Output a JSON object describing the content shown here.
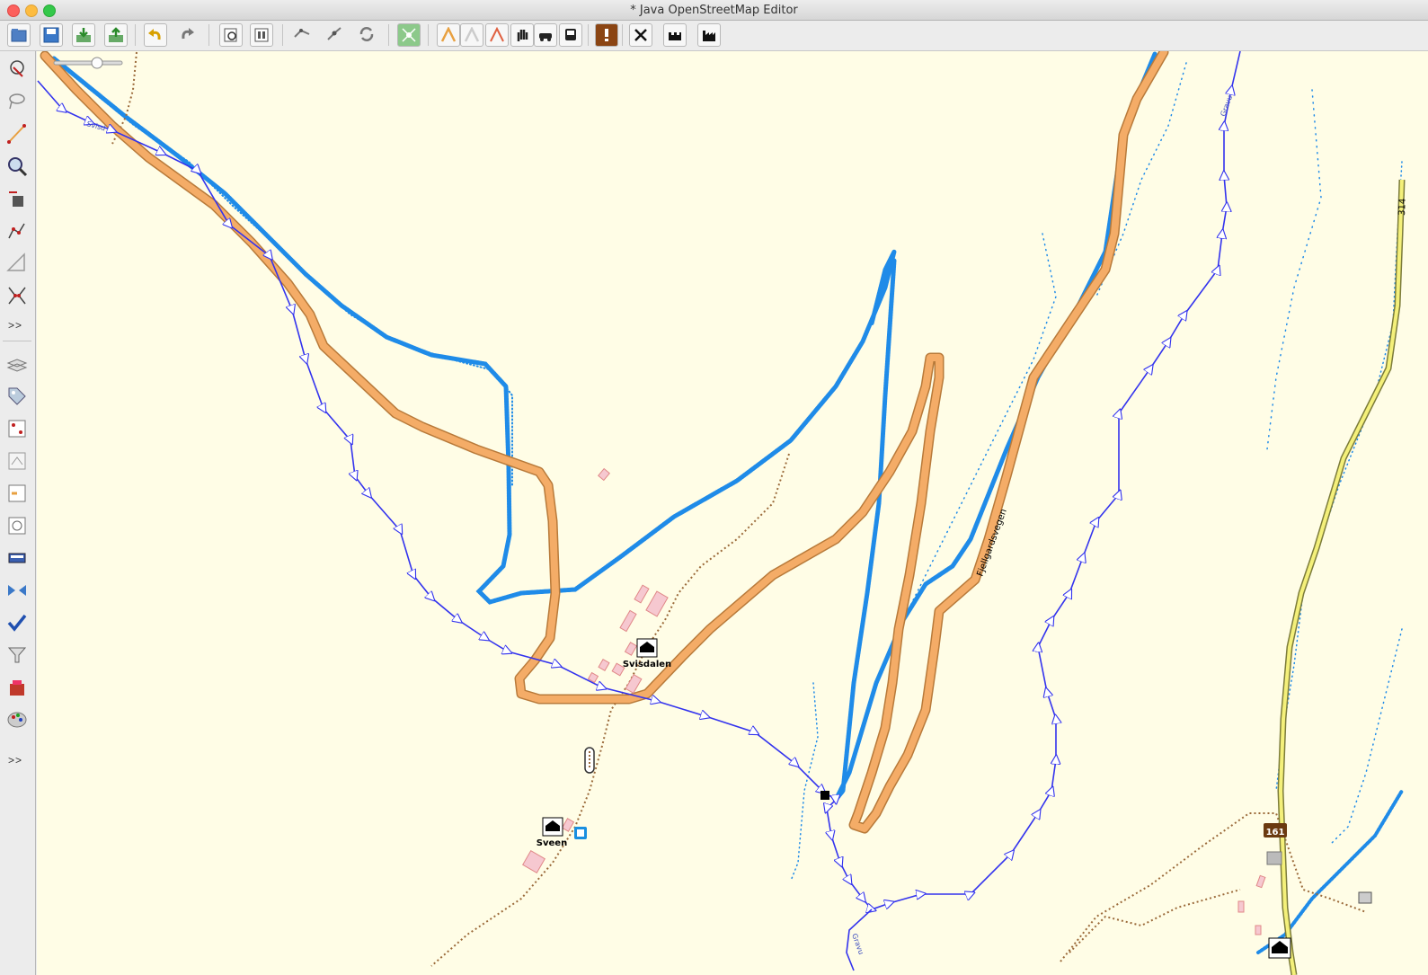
{
  "window": {
    "title": "* Java OpenStreetMap Editor"
  },
  "toolbar": {
    "items": [
      {
        "name": "open-file-button"
      },
      {
        "name": "save-button"
      },
      {
        "name": "download-button"
      },
      {
        "name": "upload-button"
      },
      {
        "name": "undo-button"
      },
      {
        "name": "redo-button"
      },
      {
        "name": "preferences-button"
      },
      {
        "name": "layer-properties-button"
      },
      {
        "name": "split-way-button"
      },
      {
        "name": "combine-way-button"
      },
      {
        "name": "update-data-button"
      },
      {
        "name": "wireframe-toggle-button"
      },
      {
        "name": "highway-preset-button"
      },
      {
        "name": "track-preset-button"
      },
      {
        "name": "path-preset-button"
      },
      {
        "name": "barrier-preset-button"
      },
      {
        "name": "car-preset-button"
      },
      {
        "name": "bus-preset-button"
      },
      {
        "name": "validation-warning-button"
      },
      {
        "name": "restaurant-preset-button"
      },
      {
        "name": "castle-preset-button"
      },
      {
        "name": "industrial-preset-button"
      }
    ]
  },
  "sidebar": {
    "more_label_top": ">>",
    "more_label_bottom": ">>"
  },
  "map": {
    "labels": {
      "svisdalen": "Svisdalen",
      "sveen": "Sveen",
      "fjellgardsvegen": "Fjellgardsvegen",
      "route_ref": "314",
      "junction_ref": "161",
      "stream_top": "Gravu",
      "stream_bottom": "Gravu",
      "stream_left": "Svisd"
    },
    "colors": {
      "background": "#fffde6",
      "secondary_road": "#f4ac67",
      "waterway": "#3333ee",
      "gps_trace": "#1f8be8",
      "track": "#9b6a3a",
      "primary_road": "#f4f07a"
    }
  }
}
